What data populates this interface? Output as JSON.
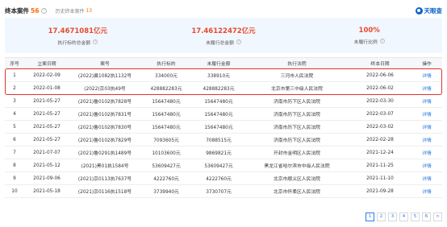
{
  "header": {
    "title": "终本案件",
    "count": "56",
    "history_label": "历史终本案件",
    "history_count": "13",
    "logo_text": "天眼查"
  },
  "summary": [
    {
      "value": "17.4671081亿元",
      "label": "执行标的总金额"
    },
    {
      "value": "17.46122472亿元",
      "label": "未履行总金额"
    },
    {
      "value": "100%",
      "label": "未履行比例"
    }
  ],
  "table": {
    "headers": [
      "序号",
      "立案日期",
      "案号",
      "执行标的",
      "未履行金额",
      "执行法院",
      "终本日期",
      "操作"
    ],
    "rows": [
      [
        "1",
        "2022-02-09",
        "(2022)冀1082执1132号",
        "334000元",
        "338910元",
        "三河市人民法院",
        "2022-06-06",
        "详情"
      ],
      [
        "2",
        "2022-01-08",
        "(2022)京03执49号",
        "428882283元",
        "428882283元",
        "北京市第三中级人民法院",
        "2022-06-02",
        "详情"
      ],
      [
        "3",
        "2021-05-27",
        "(2021)鲁0102执7828号",
        "15647480元",
        "15647480元",
        "济南市历下区人民法院",
        "2022-03-30",
        "详情"
      ],
      [
        "4",
        "2021-05-27",
        "(2021)鲁0102执7831号",
        "15647480元",
        "15647480元",
        "济南市历下区人民法院",
        "2022-03-07",
        "详情"
      ],
      [
        "5",
        "2021-05-27",
        "(2021)鲁0102执7830号",
        "15647480元",
        "15647480元",
        "济南市历下区人民法院",
        "2022-03-02",
        "详情"
      ],
      [
        "6",
        "2021-05-27",
        "(2021)鲁0102执7829号",
        "7093605元",
        "7088515元",
        "济南市历下区人民法院",
        "2022-02-28",
        "详情"
      ],
      [
        "7",
        "2021-07-07",
        "(2021)鲁0291执1489号",
        "10103600元",
        "9869821元",
        "开封市金明区人民法院",
        "2021-12-24",
        "详情"
      ],
      [
        "8",
        "2021-05-12",
        "(2021)黑01执1584号",
        "53609427元",
        "53609427元",
        "黑龙江省哈尔滨市中级人民法院",
        "2021-11-25",
        "详情"
      ],
      [
        "9",
        "2021-09-06",
        "(2021)京0113执7637号",
        "4222760元",
        "4222760元",
        "北京市顺义区人民法院",
        "2021-11-10",
        "详情"
      ],
      [
        "10",
        "2021-05-18",
        "(2021)京0116执1518号",
        "3739940元",
        "3730707元",
        "北京市怀柔区人民法院",
        "2021-09-28",
        "详情"
      ]
    ]
  },
  "pager": {
    "pages": [
      "1",
      "2",
      "3",
      "4",
      "5",
      "6"
    ],
    "next": ">"
  },
  "colors": {
    "accent": "#ff6a00",
    "amount": "#e64a2e",
    "link": "#2b7be3",
    "highlight": "#e53030",
    "summary_bg": "#f1f7ff"
  }
}
